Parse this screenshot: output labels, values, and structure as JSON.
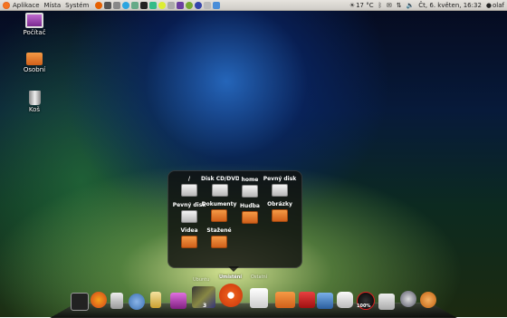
{
  "panel": {
    "menus": [
      "Aplikace",
      "Místa",
      "Systém"
    ],
    "weather": "17 °C",
    "datetime": "Čt, 6. květen, 16:32",
    "user": "olaf"
  },
  "desktop": {
    "icons": [
      {
        "label": "Počítač",
        "icon": "computer-icon"
      },
      {
        "label": "Osobní",
        "icon": "home-folder-icon"
      },
      {
        "label": "Koš",
        "icon": "trash-icon"
      }
    ]
  },
  "stack": {
    "items": [
      {
        "label": "/",
        "icon": "drive-icon"
      },
      {
        "label": "Disk CD/DVD",
        "icon": "optical-drive-icon"
      },
      {
        "label": "home",
        "icon": "drive-icon"
      },
      {
        "label": "Pevný disk",
        "icon": "drive-icon"
      },
      {
        "label": "Pevný disk",
        "icon": "drive-icon"
      },
      {
        "label": "Dokumenty",
        "icon": "folder-icon"
      },
      {
        "label": "Hudba",
        "icon": "folder-icon"
      },
      {
        "label": "Obrázky",
        "icon": "folder-icon"
      },
      {
        "label": "Videa",
        "icon": "folder-icon"
      },
      {
        "label": "Stažené",
        "icon": "folder-icon"
      }
    ]
  },
  "dock": {
    "label_left": "Ubuntu",
    "label_center": "Umístění",
    "label_right": "Ostatní",
    "badge": "3",
    "battery_percent": "100%",
    "icons": [
      "terminal-icon",
      "firefox-icon",
      "calculator-icon",
      "pidgin-icon",
      "paint-icon",
      "video-icon",
      "photos-icon",
      "ubuntu-icon",
      "notes-icon",
      "folder-icon",
      "shutdown-icon",
      "virtualbox-icon",
      "printer-icon",
      "network-monitor-icon",
      "gwibber-icon",
      "chrome-icon",
      "clock-icon",
      "ubuntu-one-icon"
    ]
  }
}
